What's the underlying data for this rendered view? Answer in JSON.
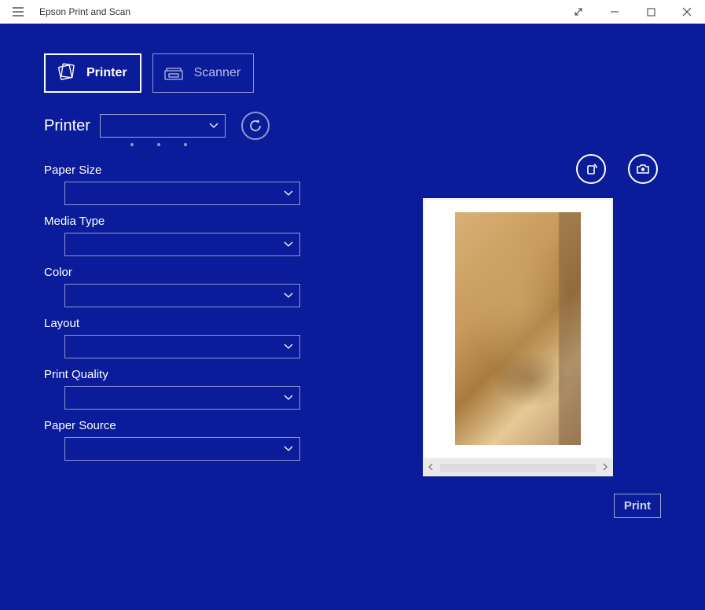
{
  "window": {
    "title": "Epson Print and Scan"
  },
  "tabs": {
    "printer": "Printer",
    "scanner": "Scanner"
  },
  "printer_select": {
    "label": "Printer",
    "value": ""
  },
  "fields": {
    "paper_size": {
      "label": "Paper Size",
      "value": ""
    },
    "media_type": {
      "label": "Media Type",
      "value": ""
    },
    "color": {
      "label": "Color",
      "value": ""
    },
    "layout": {
      "label": "Layout",
      "value": ""
    },
    "print_quality": {
      "label": "Print Quality",
      "value": ""
    },
    "paper_source": {
      "label": "Paper Source",
      "value": ""
    }
  },
  "buttons": {
    "print": "Print"
  },
  "icons": {
    "refresh": "refresh-icon",
    "rotate": "rotate-icon",
    "add_photo": "add-photo-icon"
  }
}
